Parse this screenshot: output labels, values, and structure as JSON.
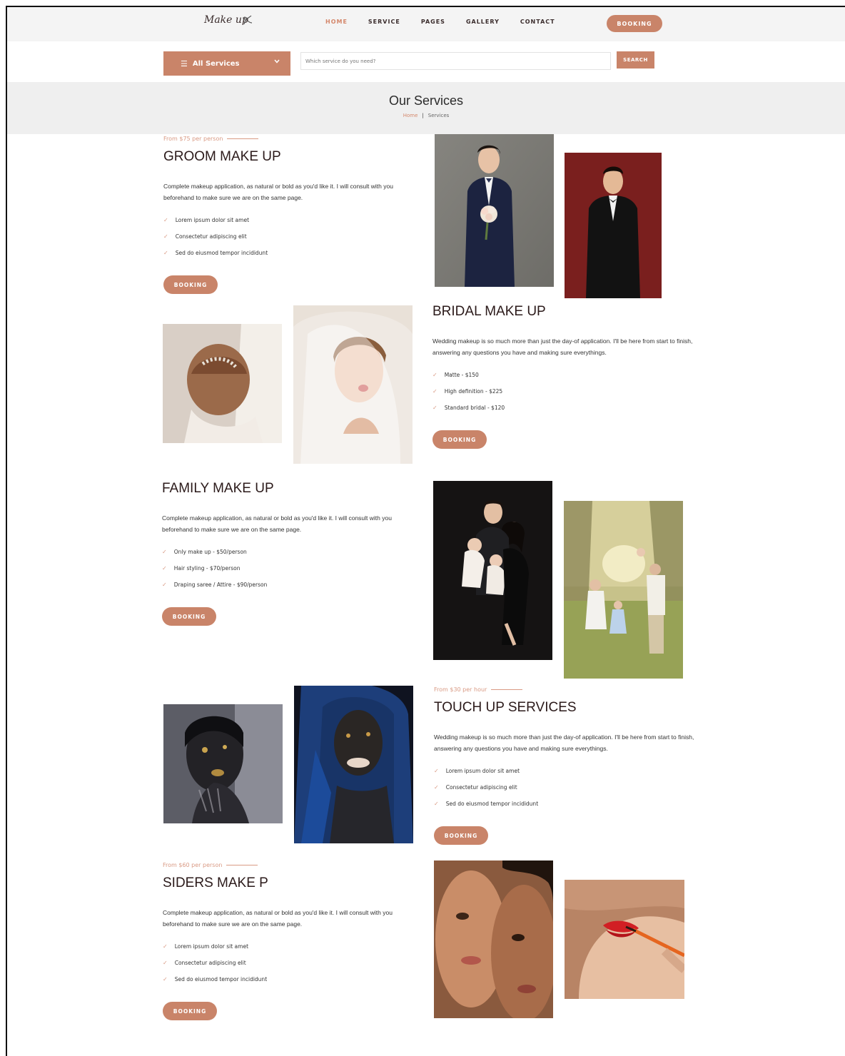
{
  "header": {
    "logo_text": "Make up",
    "nav": [
      "HOME",
      "SERVICE",
      "PAGES",
      "GALLERY",
      "CONTACT"
    ],
    "booking_label": "BOOKING"
  },
  "search": {
    "category_label": "All Services",
    "placeholder": "Which service do you need?",
    "button_label": "SEARCH"
  },
  "banner": {
    "title": "Our Services",
    "crumb_home": "Home",
    "crumb_sep": "|",
    "crumb_current": "Services"
  },
  "services": [
    {
      "price": "From $75 per person",
      "title": "GROOM MAKE UP",
      "desc": "Complete makeup application, as natural or bold as you'd like it. I will consult with you beforehand to make sure we are on the same page.",
      "items": [
        "Lorem ipsum dolor sit amet",
        "Consectetur adipiscing elit",
        "Sed do eiusmod tempor incididunt"
      ],
      "button": "BOOKING"
    },
    {
      "price": "",
      "title": "BRIDAL MAKE UP",
      "desc": "Wedding makeup is so much more than just the day-of application. I'll be here from start to finish, answering any questions you have and making sure everythings.",
      "items": [
        "Matte - $150",
        "High definition - $225",
        "Standard bridal - $120"
      ],
      "button": "BOOKING"
    },
    {
      "price": "",
      "title": "FAMILY MAKE UP",
      "desc": "Complete makeup application, as natural or bold as you'd like it. I will consult with you beforehand to make sure we are on the same page.",
      "items": [
        "Only make up - $50/person",
        "Hair styling - $70/person",
        "Draping saree / Attire - $90/person"
      ],
      "button": "BOOKING"
    },
    {
      "price": "From $30 per hour",
      "title": "TOUCH UP SERVICES",
      "desc": "Wedding makeup is so much more than just the day-of application. I'll be here from start to finish, answering any questions you have and making sure everythings.",
      "items": [
        "Lorem ipsum dolor sit amet",
        "Consectetur adipiscing elit",
        "Sed do eiusmod tempor incididunt"
      ],
      "button": "BOOKING"
    },
    {
      "price": "From $60 per person",
      "title": "SIDERS MAKE P",
      "desc": "Complete makeup application, as natural or bold as you'd like it. I will consult with you beforehand to make sure we are on the same page.",
      "items": [
        "Lorem ipsum dolor sit amet",
        "Consectetur adipiscing elit",
        "Sed do eiusmod tempor incididunt"
      ],
      "button": "BOOKING"
    }
  ],
  "colors": {
    "accent": "#c98469",
    "accent_light": "#d99a84",
    "banner_bg": "#efefef",
    "topbar_bg": "#f4f4f4"
  },
  "icons": [
    "menu-icon",
    "chevron-down-icon",
    "check-icon",
    "logo-mark-icon"
  ]
}
